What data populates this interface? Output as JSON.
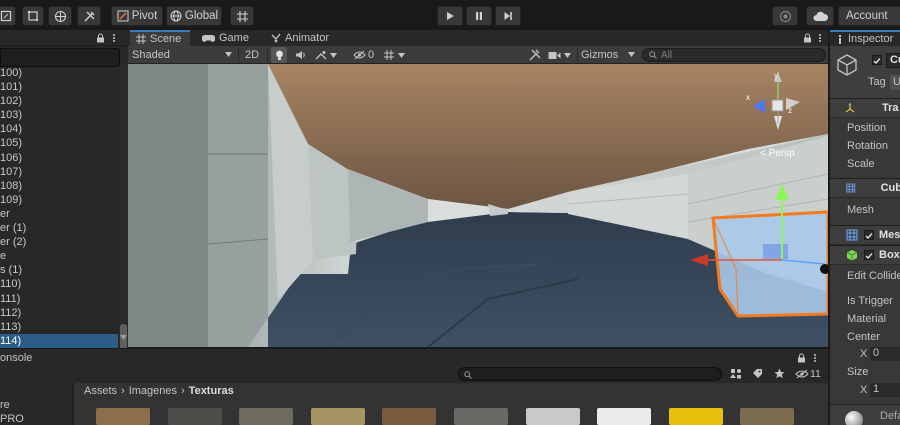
{
  "toolbar": {
    "pivot_label": "Pivot",
    "global_label": "Global",
    "account_label": "Account"
  },
  "hierarchy": {
    "items": [
      "100)",
      "101)",
      "102)",
      "103)",
      "104)",
      "105)",
      "106)",
      "107)",
      "108)",
      "109)",
      "er",
      "er (1)",
      "er (2)",
      "e",
      "s (1)",
      "110)",
      "111)",
      "112)",
      "113)",
      "114)"
    ],
    "selected_index": 19
  },
  "scene_tabs": {
    "tabs": [
      "Scene",
      "Game",
      "Animator"
    ],
    "active": "Scene"
  },
  "scene_toolbar": {
    "shading_mode": "Shaded",
    "mode_2d": "2D",
    "hidden_count": "0",
    "gizmos_label": "Gizmos",
    "search_placeholder": "All"
  },
  "viewport": {
    "persp_label": "< Persp",
    "axis_labels": [
      "y",
      "x",
      "z"
    ]
  },
  "inspector": {
    "tab_label": "Inspector",
    "object_name": "Cu",
    "tag_label": "Tag",
    "tag_value": "U",
    "components": {
      "transform": "Tra",
      "cube_filter": "Cub",
      "mesh_renderer": "Mes",
      "box_collider": "Box",
      "default_material": "Defa"
    },
    "fields": {
      "position": "Position",
      "rotation": "Rotation",
      "scale": "Scale",
      "mesh": "Mesh",
      "edit_collider": "Edit Collide",
      "is_trigger": "Is Trigger",
      "material": "Material",
      "center": "Center",
      "center_x_label": "X",
      "center_x_value": "0",
      "size": "Size",
      "size_x_label": "X",
      "size_x_value": "1"
    }
  },
  "console": {
    "tab_label": "onsole"
  },
  "project": {
    "breadcrumb": [
      "Assets",
      "Imagenes",
      "Texturas"
    ],
    "left_items": [
      "re",
      "PRO"
    ],
    "hidden_count": "11",
    "texture_colors": [
      "#8a6f4a",
      "#4f4d4a",
      "#6e6b5e",
      "#a59563",
      "#7b5c3e",
      "#6b6966",
      "#c9c9c7",
      "#ebebea",
      "#e7c00a",
      "#7d6d4e"
    ]
  },
  "colors": {
    "accent": "#3a79bb",
    "selection": "#2c5d87",
    "bounds_orange": "#f47a20"
  }
}
